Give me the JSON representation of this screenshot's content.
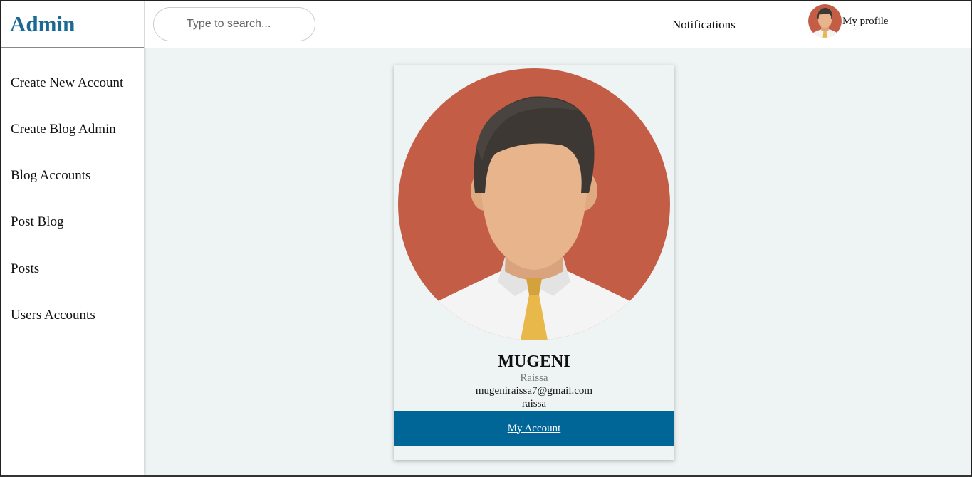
{
  "sidebar": {
    "brand": "Admin",
    "items": [
      {
        "label": "Create New Account"
      },
      {
        "label": "Create Blog Admin"
      },
      {
        "label": "Blog Accounts"
      },
      {
        "label": "Post Blog"
      },
      {
        "label": "Posts"
      },
      {
        "label": "Users Accounts"
      }
    ]
  },
  "header": {
    "search_placeholder": "Type to search...",
    "notifications_label": "Notifications",
    "profile_label": "My profile"
  },
  "card": {
    "name": "MUGENI",
    "first_name": "Raissa",
    "email": "mugeniraissa7@gmail.com",
    "username": "raissa",
    "account_link": "My Account"
  },
  "colors": {
    "brand": "#1b6a93",
    "accent_button": "#006698",
    "avatar_bg": "#c45d45",
    "tie": "#e9b84a",
    "hair": "#3d3834",
    "skin": "#e8b48b"
  }
}
